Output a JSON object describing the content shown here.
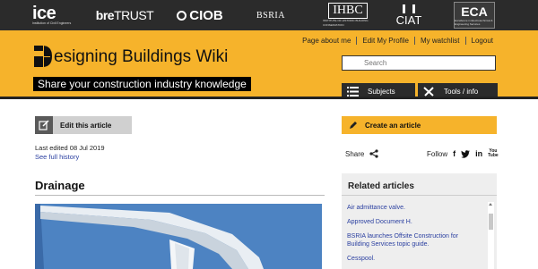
{
  "partners": {
    "ice": {
      "name": "ice",
      "sub": "Institution of Civil Engineers"
    },
    "bre": {
      "bold": "bre",
      "thin": "TRUST"
    },
    "ciob": "CIOB",
    "bsria": "BSRIA",
    "ihbc": {
      "name": "IHBC",
      "sub": "INSTITUTE OF HISTORIC BUILDING CONSERVATION"
    },
    "ciat": "CIAT",
    "eca": {
      "name": "ECA",
      "sub": "Excellence in Electrotechnical & Engineering Services"
    }
  },
  "user_links": [
    "Page about me",
    "Edit My Profile",
    "My watchlist",
    "Logout"
  ],
  "site": {
    "title": "esigning Buildings Wiki",
    "tagline": "Share your construction industry knowledge"
  },
  "search": {
    "placeholder": "Search"
  },
  "header_buttons": {
    "subjects": "Subjects",
    "tools": "Tools / info"
  },
  "article": {
    "edit_label": "Edit this article",
    "last_edited": "Last edited 08 Jul 2019",
    "history_link": "See full history",
    "title": "Drainage"
  },
  "sidebar": {
    "create_label": "Create an article",
    "share_label": "Share",
    "follow_label": "Follow",
    "social": {
      "facebook": "f",
      "linkedin": "in",
      "youtube": "You\nTube"
    },
    "related_heading": "Related articles",
    "related": [
      "Air admittance valve.",
      "Approved Document H.",
      "BSRIA launches Offsite Construction for Building Services topic guide.",
      "Cesspool."
    ]
  },
  "colors": {
    "accent": "#f6b32b",
    "dark": "#2b2b2b",
    "link": "#2a3fa0"
  }
}
